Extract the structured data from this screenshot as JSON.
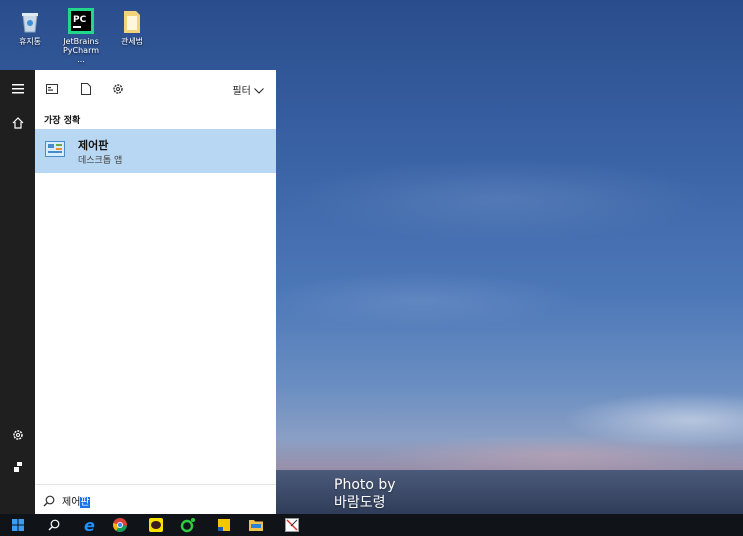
{
  "desktop": {
    "icons": [
      {
        "label": "휴지통",
        "icon": "recycle-bin-icon"
      },
      {
        "label": "JetBrains PyCharm ...",
        "icon": "pycharm-icon"
      },
      {
        "label": "관세법",
        "icon": "folder-icon"
      }
    ],
    "photo_credit_line1": "Photo by",
    "photo_credit_line2": "바람도령"
  },
  "start_rail": {
    "items": [
      "hamburger-menu-icon",
      "home-icon",
      "settings-icon",
      "user-icon"
    ]
  },
  "search_panel": {
    "toolbar_icons": [
      "apps-icon",
      "documents-icon",
      "settings-icon"
    ],
    "filter_label": "필터",
    "section_label": "가장 정확",
    "best_match": {
      "title": "제어판",
      "subtitle": "데스크톱 앱"
    },
    "query_plain": "제어",
    "query_selected": "판"
  },
  "taskbar": {
    "items": [
      "start-icon",
      "search-icon",
      "edge-icon",
      "chrome-icon",
      "kakaotalk-icon",
      "line-app-icon",
      "sticky-notes-icon",
      "file-explorer-icon",
      "scissors-app-icon"
    ],
    "accent": "#1a73e8"
  }
}
